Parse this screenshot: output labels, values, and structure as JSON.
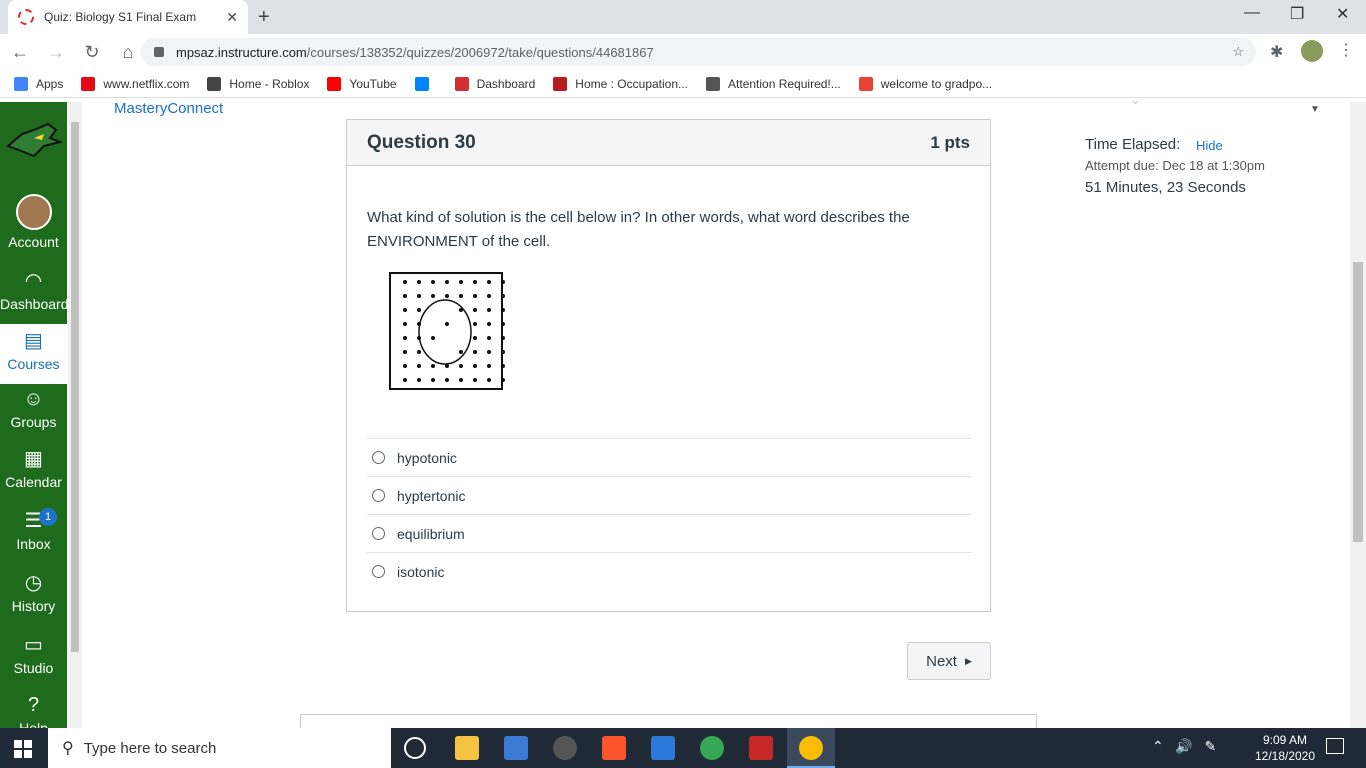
{
  "browser": {
    "tab_title": "Quiz: Biology S1 Final Exam",
    "url_host": "mpsaz.instructure.com",
    "url_path": "/courses/138352/quizzes/2006972/take/questions/44681867",
    "bookmarks": [
      {
        "label": "Apps",
        "icon": "apps-grid-icon",
        "color": "#4285f4"
      },
      {
        "label": "www.netflix.com",
        "icon": "netflix-icon",
        "color": "#e50914"
      },
      {
        "label": "Home - Roblox",
        "icon": "roblox-icon",
        "color": "#444444"
      },
      {
        "label": "YouTube",
        "icon": "youtube-icon",
        "color": "#ff0000"
      },
      {
        "label": "",
        "icon": "messenger-icon",
        "color": "#0084ff"
      },
      {
        "label": "Dashboard",
        "icon": "canvas-icon",
        "color": "#d32f2f"
      },
      {
        "label": "Home : Occupation...",
        "icon": "star-flag-icon",
        "color": "#b71c1c"
      },
      {
        "label": "Attention Required!...",
        "icon": "globe-icon",
        "color": "#555555"
      },
      {
        "label": "welcome to gradpo...",
        "icon": "gmail-icon",
        "color": "#ea4335"
      }
    ]
  },
  "leftnav": {
    "items": [
      {
        "label": "Account",
        "icon": "avatar"
      },
      {
        "label": "Dashboard",
        "icon": "dashboard-icon"
      },
      {
        "label": "Courses",
        "icon": "courses-icon",
        "active": true
      },
      {
        "label": "Groups",
        "icon": "groups-icon"
      },
      {
        "label": "Calendar",
        "icon": "calendar-icon"
      },
      {
        "label": "Inbox",
        "icon": "inbox-icon",
        "badge": "1"
      },
      {
        "label": "History",
        "icon": "history-icon"
      },
      {
        "label": "Studio",
        "icon": "studio-icon"
      },
      {
        "label": "Help",
        "icon": "help-icon"
      }
    ]
  },
  "page": {
    "mastery_link": "MasteryConnect"
  },
  "question": {
    "title": "Question 30",
    "points": "1 pts",
    "text": "What kind of solution is the cell below in? In other words, what word describes the ENVIRONMENT of the cell.",
    "answers": [
      "hypotonic",
      "hyptertonic",
      "equilibrium",
      "isotonic"
    ]
  },
  "navigation": {
    "next_label": "Next"
  },
  "sidebar": {
    "timer_label": "Time Elapsed:",
    "hide_label": "Hide",
    "attempt_due": "Attempt due: Dec 18 at 1:30pm",
    "elapsed": "51 Minutes, 23 Seconds"
  },
  "taskbar": {
    "search_placeholder": "Type here to search",
    "time": "9:09 AM",
    "date": "12/18/2020"
  }
}
